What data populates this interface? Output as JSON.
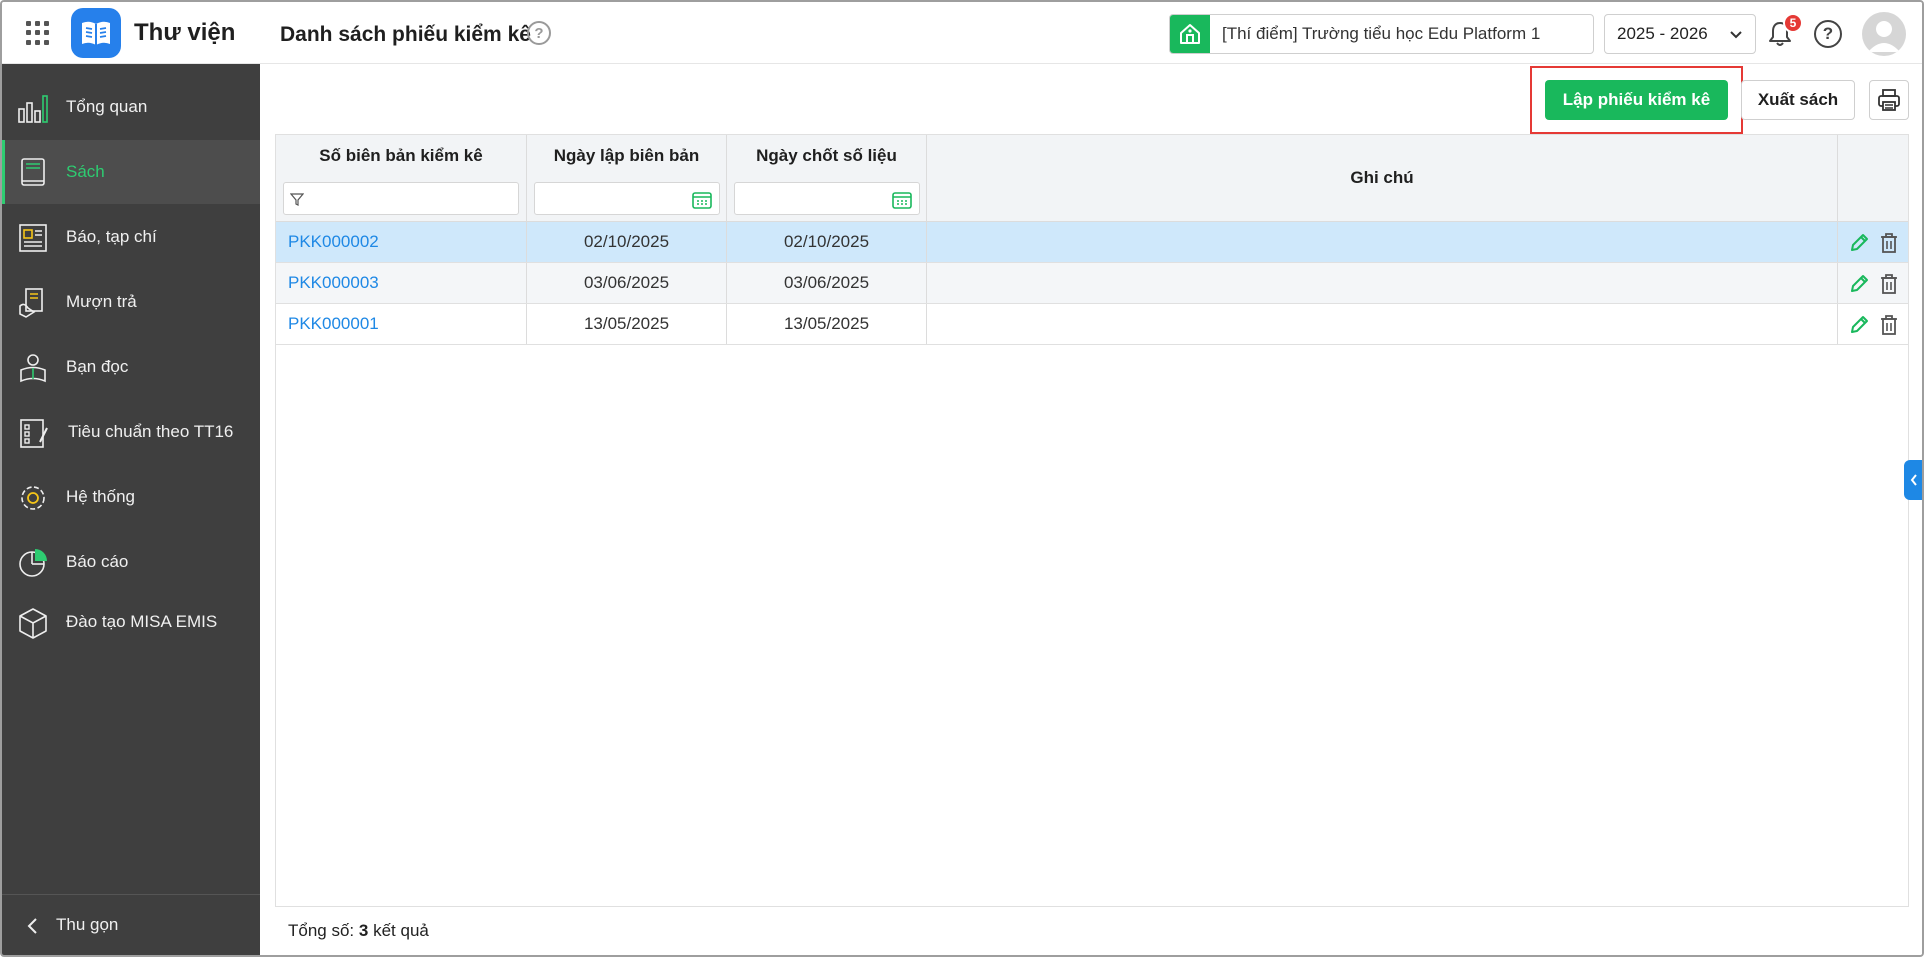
{
  "header": {
    "app_title": "Thư viện",
    "page_title": "Danh sách phiếu kiểm kê",
    "help_symbol": "?",
    "school": "[Thí điểm] Trường tiểu học Edu Platform 1",
    "year": "2025 - 2026",
    "notification_count": "5",
    "help_big_symbol": "?"
  },
  "sidebar": {
    "items": [
      {
        "label": "Tổng quan",
        "icon": "chart-bars-icon"
      },
      {
        "label": "Sách",
        "icon": "book-icon",
        "active": true
      },
      {
        "label": "Báo, tạp chí",
        "icon": "newspaper-icon"
      },
      {
        "label": "Mượn trả",
        "icon": "borrow-return-icon"
      },
      {
        "label": "Bạn đọc",
        "icon": "reader-icon"
      },
      {
        "label": "Tiêu chuẩn theo TT16",
        "icon": "checklist-icon"
      },
      {
        "label": "Hệ thống",
        "icon": "gear-icon"
      },
      {
        "label": "Báo cáo",
        "icon": "pie-chart-icon"
      },
      {
        "label": "Đào tạo MISA EMIS",
        "icon": "cube-icon"
      }
    ],
    "collapse_label": "Thu gọn"
  },
  "toolbar": {
    "create_label": "Lập phiếu kiểm kê",
    "export_label": "Xuất sách"
  },
  "table": {
    "columns": [
      "Số biên bản kiểm kê",
      "Ngày lập biên bản",
      "Ngày chốt số liệu",
      "Ghi chú"
    ],
    "rows": [
      {
        "code": "PKK000002",
        "created": "02/10/2025",
        "closed": "02/10/2025",
        "note": ""
      },
      {
        "code": "PKK000003",
        "created": "03/06/2025",
        "closed": "03/06/2025",
        "note": ""
      },
      {
        "code": "PKK000001",
        "created": "13/05/2025",
        "closed": "13/05/2025",
        "note": ""
      }
    ]
  },
  "footer": {
    "prefix": "Tổng số:",
    "count": "3",
    "suffix": "kết quả"
  },
  "colors": {
    "primary_green": "#19b85c",
    "sidebar_bg": "#3f3f3f",
    "link_blue": "#1e88e5",
    "selected_row": "#cfe8fb",
    "highlight_red": "#e53935"
  }
}
